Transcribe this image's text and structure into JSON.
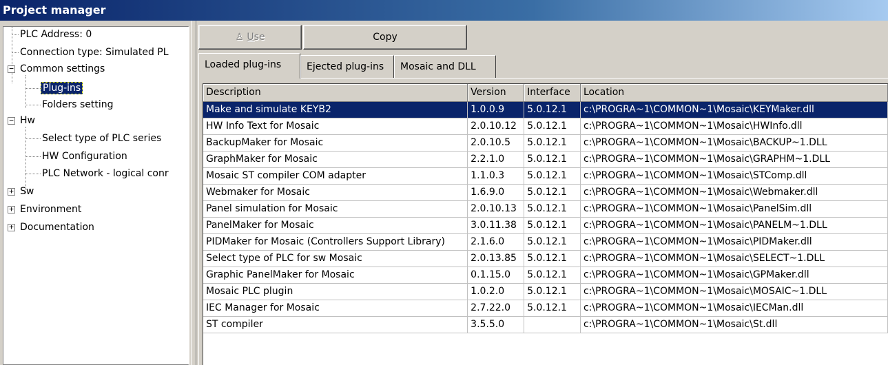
{
  "title": "Project manager",
  "tree": {
    "plc_address": "PLC Address: 0",
    "connection_type": "Connection type: Simulated PL",
    "common_settings": "Common settings",
    "plugins": "Plug-ins",
    "folders_setting": "Folders setting",
    "hw": "Hw",
    "select_type": "Select type of PLC series",
    "hw_configuration": "HW Configuration",
    "plc_network": "PLC Network - logical conr",
    "sw": "Sw",
    "environment": "Environment",
    "documentation": "Documentation"
  },
  "toolbar": {
    "use_prefix": "",
    "use_underlined": "U",
    "use_rest": "se",
    "copy_label": "Copy"
  },
  "tabs": {
    "loaded": "Loaded plug-ins",
    "ejected": "Ejected plug-ins",
    "mosaic_dll": "Mosaic and DLL"
  },
  "table": {
    "headers": {
      "description": "Description",
      "version": "Version",
      "interface": "Interface",
      "location": "Location"
    },
    "rows": [
      {
        "description": "Make and simulate KEYB2",
        "version": "1.0.0.9",
        "interface": "5.0.12.1",
        "location": "c:\\PROGRA~1\\COMMON~1\\Mosaic\\KEYMaker.dll"
      },
      {
        "description": "HW Info Text for Mosaic",
        "version": "2.0.10.12",
        "interface": "5.0.12.1",
        "location": "c:\\PROGRA~1\\COMMON~1\\Mosaic\\HWInfo.dll"
      },
      {
        "description": "BackupMaker for Mosaic",
        "version": "2.0.10.5",
        "interface": "5.0.12.1",
        "location": "c:\\PROGRA~1\\COMMON~1\\Mosaic\\BACKUP~1.DLL"
      },
      {
        "description": "GraphMaker for Mosaic",
        "version": "2.2.1.0",
        "interface": "5.0.12.1",
        "location": "c:\\PROGRA~1\\COMMON~1\\Mosaic\\GRAPHM~1.DLL"
      },
      {
        "description": "Mosaic ST compiler COM adapter",
        "version": "1.1.0.3",
        "interface": "5.0.12.1",
        "location": "c:\\PROGRA~1\\COMMON~1\\Mosaic\\STComp.dll"
      },
      {
        "description": "Webmaker for Mosaic",
        "version": "1.6.9.0",
        "interface": "5.0.12.1",
        "location": "c:\\PROGRA~1\\COMMON~1\\Mosaic\\Webmaker.dll"
      },
      {
        "description": "Panel simulation for Mosaic",
        "version": "2.0.10.13",
        "interface": "5.0.12.1",
        "location": "c:\\PROGRA~1\\COMMON~1\\Mosaic\\PanelSim.dll"
      },
      {
        "description": "PanelMaker for Mosaic",
        "version": "3.0.11.38",
        "interface": "5.0.12.1",
        "location": "c:\\PROGRA~1\\COMMON~1\\Mosaic\\PANELM~1.DLL"
      },
      {
        "description": "PIDMaker for Mosaic (Controllers Support Library)",
        "version": "2.1.6.0",
        "interface": "5.0.12.1",
        "location": "c:\\PROGRA~1\\COMMON~1\\Mosaic\\PIDMaker.dll"
      },
      {
        "description": "Select type of PLC for sw Mosaic",
        "version": "2.0.13.85",
        "interface": "5.0.12.1",
        "location": "c:\\PROGRA~1\\COMMON~1\\Mosaic\\SELECT~1.DLL"
      },
      {
        "description": "Graphic PanelMaker for Mosaic",
        "version": "0.1.15.0",
        "interface": "5.0.12.1",
        "location": "c:\\PROGRA~1\\COMMON~1\\Mosaic\\GPMaker.dll"
      },
      {
        "description": "Mosaic PLC plugin",
        "version": "1.0.2.0",
        "interface": "5.0.12.1",
        "location": "c:\\PROGRA~1\\COMMON~1\\Mosaic\\MOSAIC~1.DLL"
      },
      {
        "description": "IEC Manager for Mosaic",
        "version": "2.7.22.0",
        "interface": "5.0.12.1",
        "location": "c:\\PROGRA~1\\COMMON~1\\Mosaic\\IECMan.dll"
      },
      {
        "description": "ST compiler",
        "version": "3.5.5.0",
        "interface": "",
        "location": "c:\\PROGRA~1\\COMMON~1\\Mosaic\\St.dll"
      }
    ]
  }
}
